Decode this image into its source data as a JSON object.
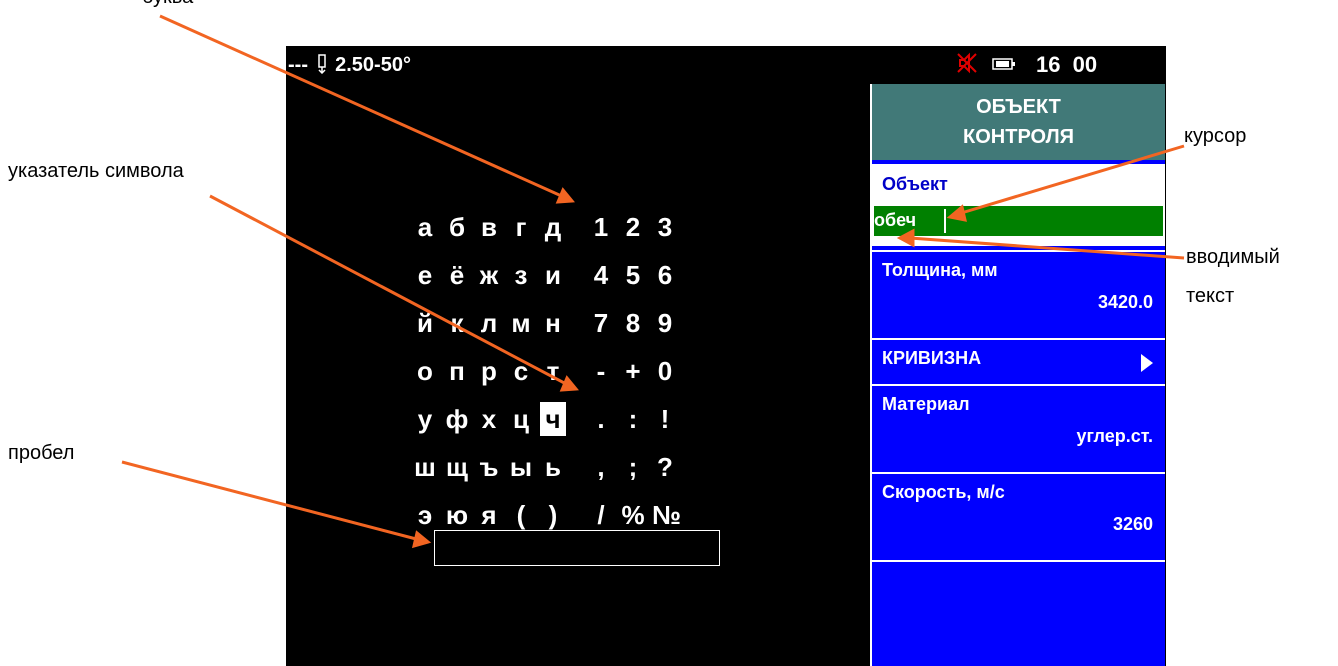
{
  "callouts": {
    "letter": "буква",
    "pointer": "указатель символа",
    "space": "пробел",
    "cursor": "курсор",
    "text_line1": "вводимый",
    "text_line2": "текст"
  },
  "status": {
    "probe_dashes": "---",
    "probe_params": "2.50-50°",
    "clock": "16 00",
    "icons": [
      "probe-icon",
      "mute-icon",
      "battery-icon"
    ]
  },
  "keyboard": {
    "rows": [
      [
        "а",
        "б",
        "в",
        "г",
        "д",
        "1",
        "2",
        "3"
      ],
      [
        "е",
        "ё",
        "ж",
        "з",
        "и",
        "4",
        "5",
        "6"
      ],
      [
        "й",
        "к",
        "л",
        "м",
        "н",
        "7",
        "8",
        "9"
      ],
      [
        "о",
        "п",
        "р",
        "с",
        "т",
        "-",
        "+",
        "0"
      ],
      [
        "у",
        "ф",
        "х",
        "ц",
        "ч",
        ".",
        ":",
        "!"
      ],
      [
        "ш",
        "щ",
        "ъ",
        "ы",
        "ь",
        ",",
        ";",
        "?"
      ],
      [
        "э",
        "ю",
        "я",
        "(",
        ")",
        "/",
        "%",
        "№"
      ]
    ],
    "selected": "ч"
  },
  "panel": {
    "header_line1": "ОБЪЕКТ",
    "header_line2": "КОНТРОЛЯ",
    "object_label": "Объект",
    "object_value": "обеч",
    "thickness_label": "Толщина, мм",
    "thickness_value": "3420.0",
    "curvature_label": "КРИВИЗНА",
    "material_label": "Материал",
    "material_value": "углер.ст.",
    "speed_label": "Скорость, м/с",
    "speed_value": "3260"
  },
  "colors": {
    "screen_bg": "#000000",
    "panel_bg": "#0000ff",
    "header_bg": "#417978",
    "input_bg": "#008000",
    "arrow": "#f26522"
  }
}
